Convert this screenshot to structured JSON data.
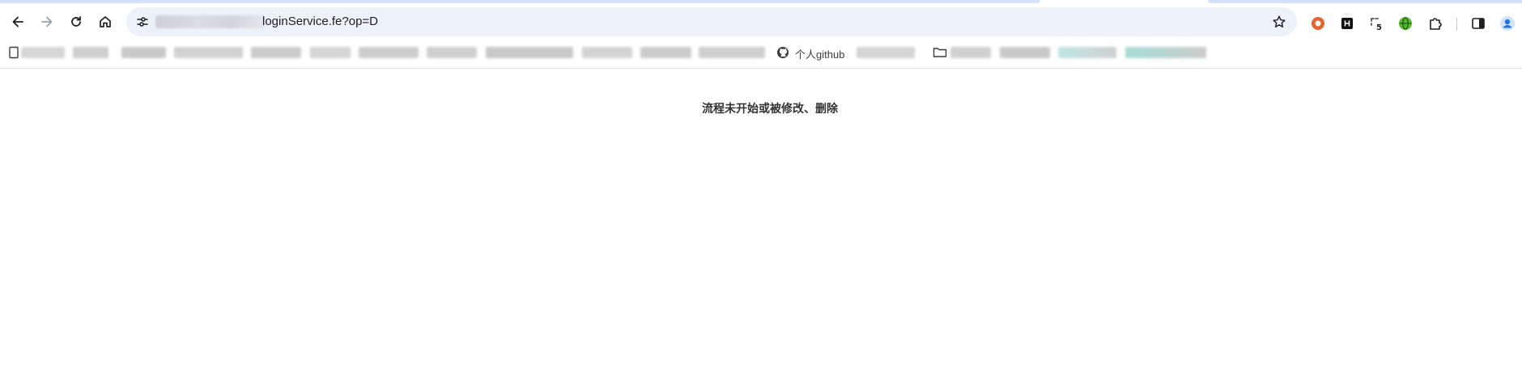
{
  "toolbar": {
    "address": "loginService.fe?op=D"
  },
  "bookmarks": {
    "items": [
      {
        "label": "个人github"
      }
    ]
  },
  "page": {
    "message": "流程未开始或被修改、删除"
  },
  "extensions": {
    "badge_count": "5",
    "colors": {
      "accent_orange": "#e8622c",
      "accent_green": "#58b82f",
      "profile_blue": "#1a73e8"
    }
  }
}
